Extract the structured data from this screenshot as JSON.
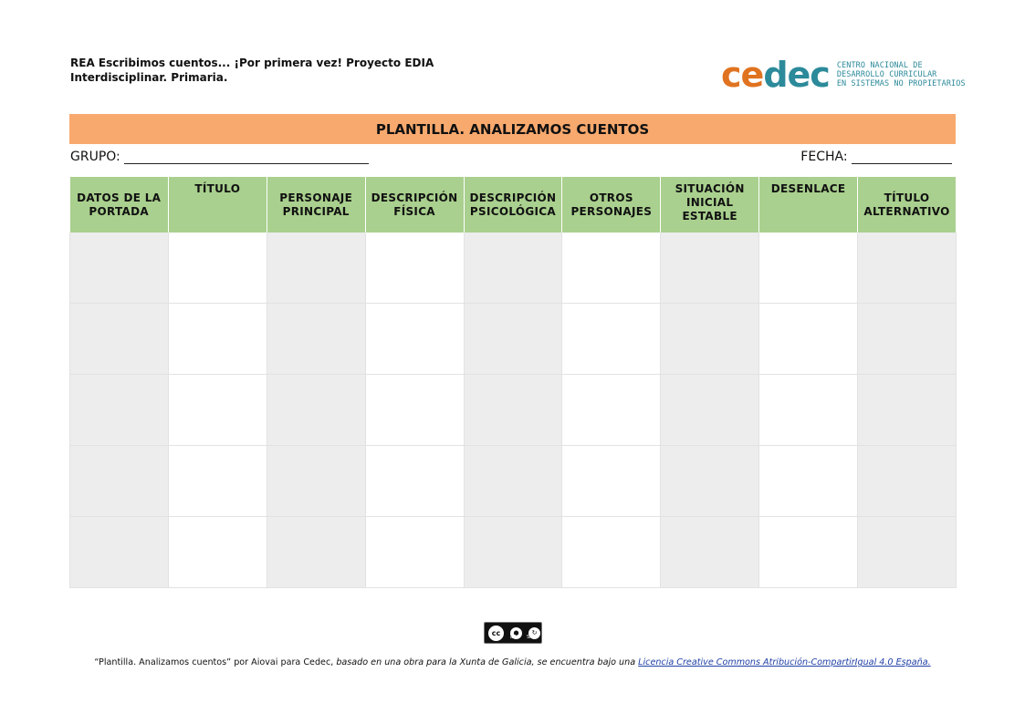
{
  "header": {
    "line1": "REA Escribimos cuentos... ¡Por primera vez! Proyecto EDIA",
    "line2": "Interdisciplinar. Primaria."
  },
  "logo": {
    "word_part1": "ce",
    "word_part2": "dec",
    "sub1": "CENTRO NACIONAL DE",
    "sub2": "DESARROLLO CURRICULAR",
    "sub3": "EN SISTEMAS NO PROPIETARIOS"
  },
  "title": "PLANTILLA. ANALIZAMOS CUENTOS",
  "meta": {
    "grupo_label": "GRUPO:",
    "fecha_label": "FECHA:"
  },
  "table": {
    "headers": [
      "DATOS DE LA PORTADA",
      "TÍTULO",
      "PERSONAJE PRINCIPAL",
      "DESCRIPCIÓN FÍSICA",
      "DESCRIPCIÓN PSICOLÓGICA",
      "OTROS PERSONAJES",
      "SITUACIÓN INICIAL ESTABLE",
      "DESENLACE",
      "TÍTULO ALTERNATIVO"
    ]
  },
  "license_badge": {
    "cc": "cc",
    "by": "BY",
    "sa": "SA"
  },
  "footer": {
    "part1": "“Plantilla. Analizamos cuentos” por Aiovai para Cedec,",
    "part2": " basado en una obra para la Xunta de Galicia, se encuentra bajo una ",
    "link": "Licencia Creative Commons Atribución-CompartirIgual 4.0 España."
  },
  "colors": {
    "title_bar": "#f8a96e",
    "header_row": "#a9d08e",
    "shaded_col": "#ededed",
    "logo_orange": "#e07320",
    "logo_teal": "#2c8a9a"
  }
}
